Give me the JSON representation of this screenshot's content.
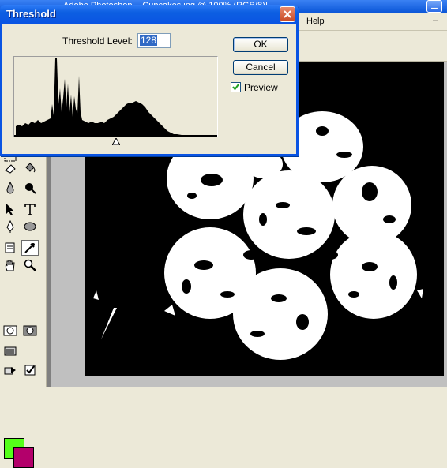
{
  "app": {
    "title_text": "Adobe Photoshop - [Cupcakes.jpg @ 100% (RGB/8)]",
    "menu_help": "Help",
    "minimize_glyph": "–",
    "window_minimize_glyph": "▁",
    "window_restore_glyph": "❐"
  },
  "dialog": {
    "title": "Threshold",
    "level_label": "Threshold Level:",
    "level_value": "128",
    "ok_label": "OK",
    "cancel_label": "Cancel",
    "preview_label": "Preview",
    "preview_checked": true,
    "slider_value": 128
  },
  "toolbox": {
    "foreground_color": "#55ff1a",
    "background_color": "#b3006b",
    "tools": [
      "marquee-icon",
      "eraser-icon",
      "paint-bucket-icon",
      "blur-icon",
      "burn-icon",
      "path-select-icon",
      "type-icon",
      "pen-icon",
      "ellipse-shape-icon",
      "notes-icon",
      "eyedropper-icon",
      "hand-icon",
      "zoom-icon",
      "standard-mode-icon",
      "quickmask-mode-icon",
      "screen-mode-icon",
      "jump-to-icon"
    ]
  },
  "colors": {
    "titlebar_blue": "#0a54e3",
    "dialog_face": "#ece9d8",
    "canvas_black": "#000000"
  }
}
